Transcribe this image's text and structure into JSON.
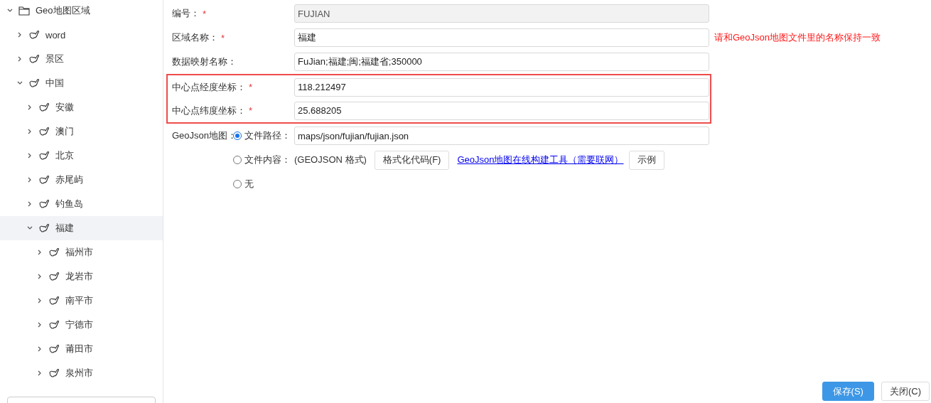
{
  "tree": [
    {
      "label": "Geo地图区域",
      "kind": "folder",
      "expanded": true,
      "selected": false,
      "children": [
        {
          "label": "word",
          "kind": "region",
          "expanded": false,
          "selected": false
        },
        {
          "label": "景区",
          "kind": "region",
          "expanded": false,
          "selected": false
        },
        {
          "label": "中国",
          "kind": "region",
          "expanded": true,
          "selected": false,
          "children": [
            {
              "label": "安徽",
              "kind": "region",
              "expanded": false,
              "selected": false
            },
            {
              "label": "澳门",
              "kind": "region",
              "expanded": false,
              "selected": false
            },
            {
              "label": "北京",
              "kind": "region",
              "expanded": false,
              "selected": false
            },
            {
              "label": "赤尾屿",
              "kind": "region",
              "expanded": false,
              "selected": false
            },
            {
              "label": "钓鱼岛",
              "kind": "region",
              "expanded": false,
              "selected": false
            },
            {
              "label": "福建",
              "kind": "region",
              "expanded": true,
              "selected": true,
              "children": [
                {
                  "label": "福州市",
                  "kind": "region",
                  "expanded": false,
                  "selected": false
                },
                {
                  "label": "龙岩市",
                  "kind": "region",
                  "expanded": false,
                  "selected": false
                },
                {
                  "label": "南平市",
                  "kind": "region",
                  "expanded": false,
                  "selected": false
                },
                {
                  "label": "宁德市",
                  "kind": "region",
                  "expanded": false,
                  "selected": false
                },
                {
                  "label": "莆田市",
                  "kind": "region",
                  "expanded": false,
                  "selected": false
                },
                {
                  "label": "泉州市",
                  "kind": "region",
                  "expanded": false,
                  "selected": false
                }
              ]
            }
          ]
        }
      ]
    }
  ],
  "form": {
    "sections": [
      {
        "kind": "plain",
        "fields": [
          {
            "label": "编号：",
            "required_mark": "*",
            "value": "FUJIAN",
            "disabled": true
          },
          {
            "label": "区域名称：",
            "required_mark": "*",
            "value": "福建",
            "disabled": false,
            "hint": "请和GeoJson地图文件里的名称保持一致"
          },
          {
            "label": "数据映射名称：",
            "value": "FuJian;福建;闽;福建省;350000",
            "disabled": false
          }
        ]
      },
      {
        "kind": "highlighted",
        "fields": [
          {
            "label": "中心点经度坐标：",
            "required_mark": "*",
            "value": "118.212497",
            "disabled": false
          },
          {
            "label": "中心点纬度坐标：",
            "required_mark": "*",
            "value": "25.688205",
            "disabled": false
          }
        ]
      }
    ],
    "geojson": {
      "label": "GeoJson地图：",
      "options": [
        {
          "label": "文件路径：",
          "selected": true,
          "kind": "path",
          "value": "maps/json/fujian/fujian.json"
        },
        {
          "label": "文件内容：",
          "selected": false,
          "kind": "content",
          "note": "(GEOJSON 格式)",
          "format_button": "格式化代码(F)",
          "link": "GeoJson地图在线构建工具（需要联网）",
          "example_button": "示例"
        },
        {
          "label": "无",
          "selected": false,
          "kind": "none"
        }
      ]
    }
  },
  "buttons": [
    {
      "label": "保存(S)",
      "kind": "primary"
    },
    {
      "label": "关闭(C)",
      "kind": "default"
    }
  ]
}
